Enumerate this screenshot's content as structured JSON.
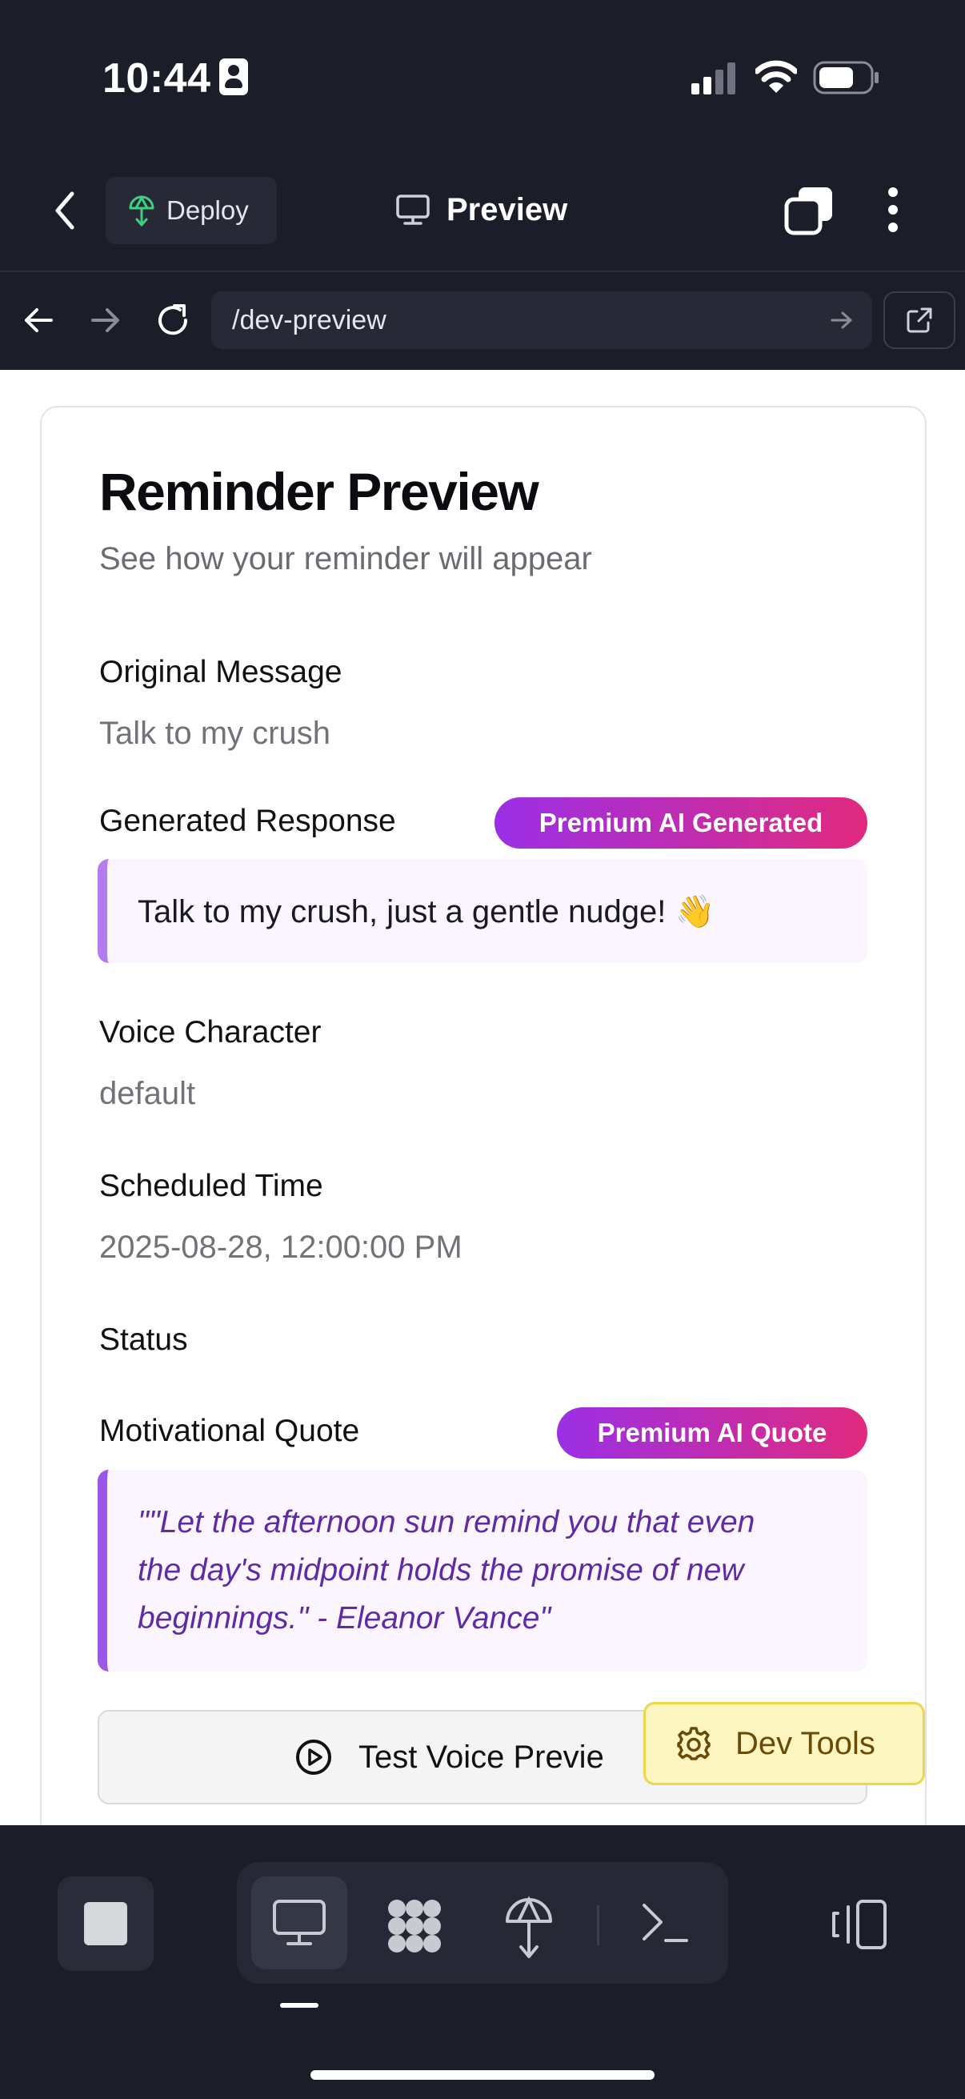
{
  "status_bar": {
    "time": "10:44",
    "battery_level": 0.6
  },
  "toolbar": {
    "deploy_label": "Deploy",
    "title": "Preview"
  },
  "browser": {
    "url": "/dev-preview"
  },
  "card": {
    "title": "Reminder Preview",
    "subtitle": "See how your reminder will appear",
    "original_message": {
      "label": "Original Message",
      "value": "Talk to my crush"
    },
    "generated_response": {
      "label": "Generated Response",
      "badge": "Premium AI Generated",
      "text": "Talk to my crush, just a gentle nudge! 👋"
    },
    "voice_character": {
      "label": "Voice Character",
      "value": "default"
    },
    "scheduled_time": {
      "label": "Scheduled Time",
      "value": "2025-08-28, 12:00:00 PM"
    },
    "status": {
      "label": "Status"
    },
    "motivational_quote": {
      "label": "Motivational Quote",
      "badge": "Premium AI Quote",
      "lines": [
        "\"\"Let the afternoon sun remind you that even",
        "the day's midpoint holds the promise of new",
        "beginnings.\" - Eleanor Vance\""
      ]
    },
    "test_voice_label": "Test Voice Previe"
  },
  "dev_tools_label": "Dev Tools",
  "colors": {
    "background": "#1b1d28",
    "accent_purple": "#9b2fe6",
    "accent_pink": "#e12a7e",
    "dev_tools_bg": "#fdf6c0"
  },
  "bottom_bar": {
    "tabs": [
      "desktop-icon",
      "workflow-icon",
      "deploy-icon",
      "terminal-icon"
    ],
    "selected_tab": "desktop-icon"
  }
}
